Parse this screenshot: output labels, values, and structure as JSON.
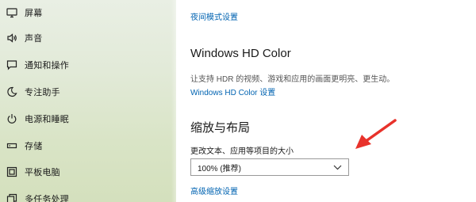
{
  "sidebar": {
    "items": [
      {
        "label": "屏幕",
        "icon": "monitor-icon"
      },
      {
        "label": "声音",
        "icon": "speaker-icon"
      },
      {
        "label": "通知和操作",
        "icon": "notification-icon"
      },
      {
        "label": "专注助手",
        "icon": "moon-icon"
      },
      {
        "label": "电源和睡眠",
        "icon": "power-icon"
      },
      {
        "label": "存储",
        "icon": "storage-icon"
      },
      {
        "label": "平板电脑",
        "icon": "tablet-icon"
      },
      {
        "label": "多任务处理",
        "icon": "multitask-icon"
      }
    ]
  },
  "main": {
    "night_light_link": "夜间模式设置",
    "hdr": {
      "title": "Windows HD Color",
      "description": "让支持 HDR 的视频、游戏和应用的画面更明亮、更生动。",
      "settings_link": "Windows HD Color 设置"
    },
    "scale": {
      "title": "缩放与布局",
      "size_label": "更改文本、应用等项目的大小",
      "size_value": "100% (推荐)",
      "advanced_link": "高级缩放设置"
    }
  },
  "colors": {
    "link": "#0063b1",
    "annotation_arrow": "#e8322b"
  }
}
